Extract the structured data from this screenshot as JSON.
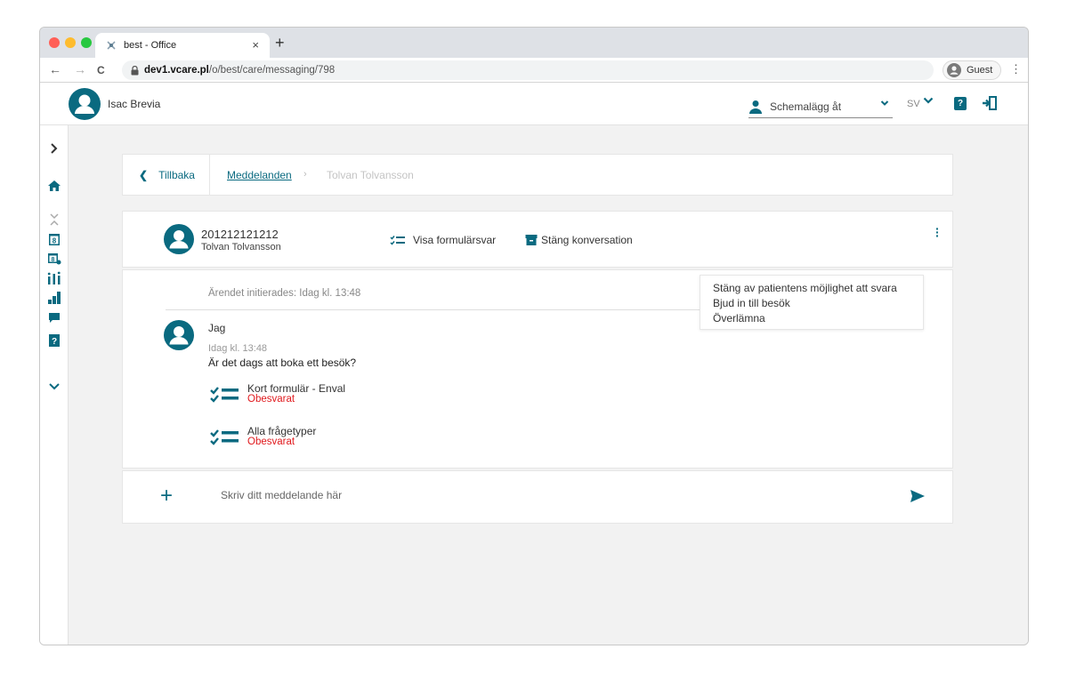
{
  "browser": {
    "tab_title": "best - Office",
    "tab_close": "×",
    "new_tab": "+",
    "url_domain": "dev1.vcare.pl",
    "url_path": "/o/best/care/messaging/798",
    "profile_label": "Guest",
    "nav_back": "←",
    "nav_forward": "→",
    "nav_reload": "C"
  },
  "header": {
    "user_name": "Isac Brevia",
    "schedule_label": "Schemalägg åt",
    "language": "SV"
  },
  "breadcrumb": {
    "back_label": "Tillbaka",
    "link_label": "Meddelanden",
    "current_label": "Tolvan Tolvansson"
  },
  "conversation": {
    "patient_id": "201212121212",
    "patient_name": "Tolvan Tolvansson",
    "view_forms_label": "Visa formulärsvar",
    "close_label": "Stäng konversation",
    "menu_items": [
      {
        "label": "Stäng av patientens möjlighet att svara"
      },
      {
        "label": "Bjud in till besök"
      },
      {
        "label": "Överlämna"
      }
    ],
    "initiated_text": "Ärendet initierades: Idag kl. 13:48",
    "message": {
      "sender": "Jag",
      "time": "Idag kl. 13:48",
      "text": "Är det dags att boka ett besök?",
      "forms": [
        {
          "title": "Kort formulär - Enval",
          "status": "Obesvarat"
        },
        {
          "title": "Alla frågetyper",
          "status": "Obesvarat"
        }
      ]
    }
  },
  "composer": {
    "placeholder": "Skriv ditt meddelande här"
  },
  "colors": {
    "accent": "#0a6a80",
    "status_unanswered": "#e0191d"
  }
}
